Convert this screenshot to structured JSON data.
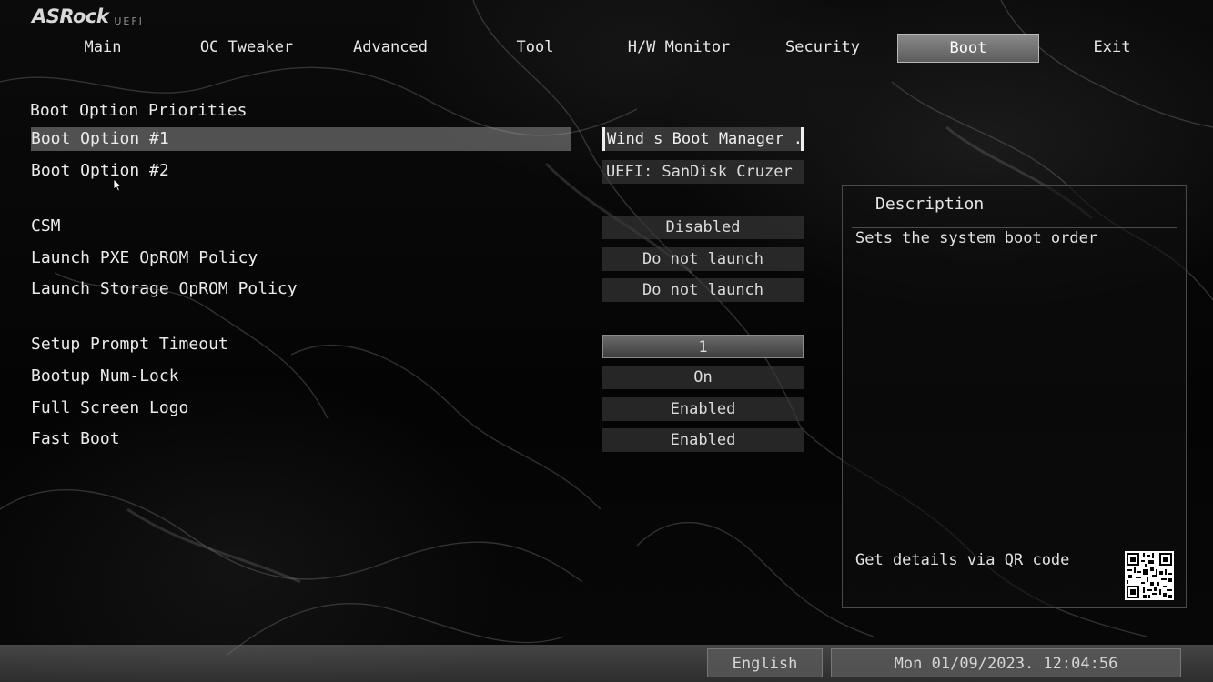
{
  "brand": {
    "logo": "ASRock",
    "subtitle": "UEFI"
  },
  "tabs": [
    {
      "label": "Main",
      "active": false
    },
    {
      "label": "OC Tweaker",
      "active": false
    },
    {
      "label": "Advanced",
      "active": false
    },
    {
      "label": "Tool",
      "active": false
    },
    {
      "label": "H/W Monitor",
      "active": false
    },
    {
      "label": "Security",
      "active": false
    },
    {
      "label": "Boot",
      "active": true
    },
    {
      "label": "Exit",
      "active": false
    }
  ],
  "boot": {
    "section_title": "Boot Option Priorities",
    "options": [
      {
        "label": "Boot Option #1",
        "value": "Wind  s Boot Manager ..."
      },
      {
        "label": "Boot Option #2",
        "value": "UEFI: SanDisk Cruzer ..."
      },
      {
        "label": "CSM",
        "value": "Disabled"
      },
      {
        "label": "Launch PXE OpROM Policy",
        "value": "Do not launch"
      },
      {
        "label": "Launch Storage OpROM Policy",
        "value": "Do not launch"
      },
      {
        "label": "Setup Prompt Timeout",
        "value": "1"
      },
      {
        "label": "Bootup Num-Lock",
        "value": "On"
      },
      {
        "label": "Full Screen Logo",
        "value": "Enabled"
      },
      {
        "label": "Fast Boot",
        "value": "Enabled"
      }
    ]
  },
  "description": {
    "title": "Description",
    "text": "Sets the system boot order",
    "qr_label": "Get details via QR code"
  },
  "status_bar": {
    "language": "English",
    "datetime": "Mon 01/09/2023. 12:04:56"
  },
  "colors": {
    "active_tab": "#767676",
    "selected_row": "#7a7a7a",
    "value_box": "#3c3c3c",
    "text": "#e6e6e6"
  }
}
